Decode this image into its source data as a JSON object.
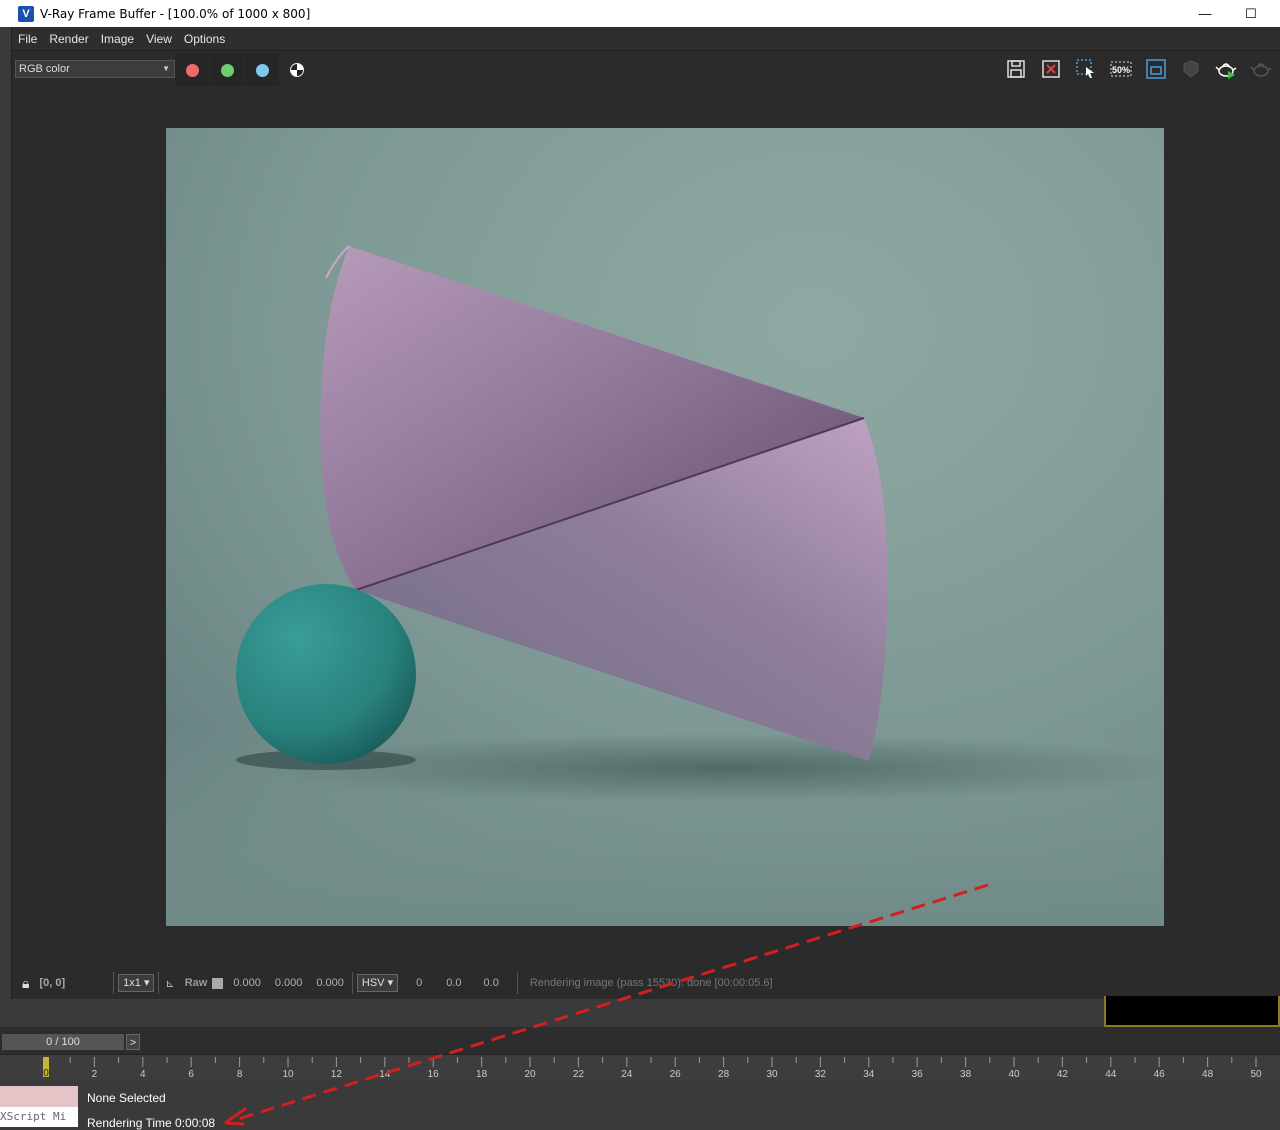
{
  "window": {
    "title": "V-Ray Frame Buffer - [100.0% of 1000 x 800]",
    "app_icon": "vray-logo-icon",
    "minimize_glyph": "—",
    "maximize_glyph": "☐"
  },
  "menu": [
    "File",
    "Render",
    "Image",
    "View",
    "Options"
  ],
  "toolbar": {
    "channel": "RGB color",
    "channel_buttons": [
      {
        "name": "red-channel",
        "color": "#ee6b6b"
      },
      {
        "name": "green-channel",
        "color": "#6fcf6f"
      },
      {
        "name": "blue-channel",
        "color": "#7ec8f0"
      }
    ],
    "zoom_label": "50%",
    "icons": [
      "save-icon",
      "clear-image-icon",
      "region-render-icon",
      "zoom-icon",
      "render-window-icon",
      "stop-icon",
      "render-teapot-icon",
      "interactive-teapot-icon"
    ]
  },
  "status": {
    "coords": "[0, 0]",
    "sample_size": "1x1",
    "raw_label": "Raw",
    "rgb": [
      "0.000",
      "0.000",
      "0.000"
    ],
    "color_mode": "HSV",
    "hsv": [
      "0",
      "0.0",
      "0.0"
    ],
    "message": "Rendering image (pass 15530): done [00:00:05.6]"
  },
  "timeline": {
    "frame_counter": "0 / 100",
    "next_label": ">",
    "current_frame": "0",
    "ticks": [
      "2",
      "4",
      "6",
      "8",
      "10",
      "12",
      "14",
      "16",
      "18",
      "20",
      "22",
      "24",
      "26",
      "28",
      "30",
      "32",
      "34",
      "36",
      "38",
      "40",
      "42",
      "44",
      "46",
      "48",
      "50"
    ]
  },
  "info": {
    "listener_text": "XScript Mi",
    "selection": "None Selected",
    "render_time": "Rendering Time  0:00:08"
  },
  "colors": {
    "annotation_arrow": "#d21f1f",
    "cone": "#a48aa8",
    "sphere": "#2f8a86",
    "background": "#86a39e"
  }
}
